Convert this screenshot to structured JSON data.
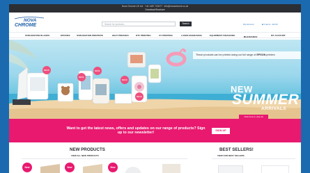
{
  "topbar": {
    "line1": "Nova Chrome UK Ltd · +44 1487 723477 · info@novachrome.co.uk",
    "line2": "Download Brochure"
  },
  "header": {
    "logo_line1": "NOVA",
    "logo_line2": "CHROME",
    "search_placeholder": "Search for products...",
    "search_button": "Search",
    "my_account": "My Account",
    "basket": "0 items - £0.00"
  },
  "nav": {
    "items": [
      "SUBLIMATION BLANKS",
      "EPOXIES",
      "SUBLIMATION PRINTERS",
      "HEAT PRESSES",
      "DTF PRINTING",
      "UV PRINTING",
      "LASER ENGRAVING",
      "EQUIPMENT FINANCING",
      "CLEARANCE",
      "MY ACCOUNT"
    ]
  },
  "hero": {
    "epson_note_prefix": "These products can be printed using our full range of",
    "epson_brand": "EPSON",
    "epson_note_suffix": "printers",
    "headline_small": "NEW",
    "headline_big": "SUMMER",
    "headline_sub": "ARRIVALS",
    "cta": "Click here to view all",
    "price_tags": [
      "SC10",
      "SC11",
      "SC11",
      "SC12",
      "SC13"
    ]
  },
  "newsletter": {
    "text": "Want to get the latest news, offers and updates on our range of products? Sign up to our newsletter!",
    "button": "SIGN UP"
  },
  "new_products": {
    "title": "NEW PRODUCTS",
    "link": "VIEW ALL NEW PRODUCTS",
    "badge": "New"
  },
  "best_sellers": {
    "title": "BEST SELLERS!",
    "link": "VIEW OUR BEST SELLERS"
  },
  "colors": {
    "frame_bg": "#1b6ab0",
    "topbar": "#2b2e33",
    "pink": "#e8196f",
    "link_blue": "#2f77c3",
    "sky": "#9bd7ec"
  }
}
